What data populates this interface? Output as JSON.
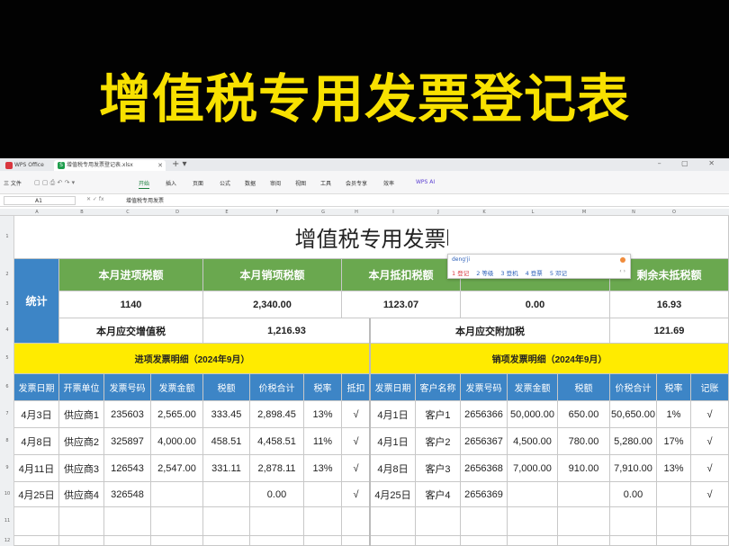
{
  "banner": {
    "title": "增值税专用发票登记表"
  },
  "tabs": [
    {
      "label": "WPS Office"
    },
    {
      "label": "增值税专用发票登记表.xlsx"
    }
  ],
  "ribbon": {
    "file": "三 文件",
    "items": [
      "开始",
      "插入",
      "页面",
      "公式",
      "数据",
      "审阅",
      "视图",
      "工具",
      "会员专享",
      "效率"
    ],
    "ai": "WPS AI",
    "active": "开始"
  },
  "formula_bar": {
    "cell_ref": "A1",
    "fx": "✕ ✓ fx",
    "value": "增值税专用发票"
  },
  "col_letters": [
    "A",
    "B",
    "C",
    "D",
    "E",
    "F",
    "G",
    "H",
    "I",
    "J",
    "K",
    "L",
    "M",
    "N",
    "O"
  ],
  "row_numbers": [
    "1",
    "2",
    "3",
    "4",
    "5",
    "6",
    "7",
    "8",
    "9",
    "10",
    "11",
    "12"
  ],
  "sheet": {
    "title": "增值税专用发票",
    "stat_label": "统计",
    "summary_headers": [
      "本月进项税额",
      "本月销项税额",
      "本月抵扣税额",
      "",
      "剩余未抵税额"
    ],
    "summary_values": [
      "1140",
      "2,340.00",
      "1123.07",
      "0.00",
      "16.93"
    ],
    "vat_due_label": "本月应交增值税",
    "vat_due_value": "1,216.93",
    "surcharge_label": "本月应交附加税",
    "surcharge_value": "121.69",
    "input_section": "进项发票明细（2024年9月）",
    "output_section": "销项发票明细（2024年9月）",
    "input_headers": [
      "发票日期",
      "开票单位",
      "发票号码",
      "发票金额",
      "税额",
      "价税合计",
      "税率",
      "抵扣"
    ],
    "output_headers": [
      "发票日期",
      "客户名称",
      "发票号码",
      "发票金额",
      "税额",
      "价税合计",
      "税率",
      "记账"
    ],
    "input_rows": [
      [
        "4月3日",
        "供应商1",
        "235603",
        "2,565.00",
        "333.45",
        "2,898.45",
        "13%",
        "√"
      ],
      [
        "4月8日",
        "供应商2",
        "325897",
        "4,000.00",
        "458.51",
        "4,458.51",
        "11%",
        "√"
      ],
      [
        "4月11日",
        "供应商3",
        "126543",
        "2,547.00",
        "331.11",
        "2,878.11",
        "13%",
        "√"
      ],
      [
        "4月25日",
        "供应商4",
        "326548",
        "",
        "",
        "0.00",
        "",
        "√"
      ]
    ],
    "output_rows": [
      [
        "4月1日",
        "客户1",
        "2656366",
        "50,000.00",
        "650.00",
        "50,650.00",
        "1%",
        "√"
      ],
      [
        "4月1日",
        "客户2",
        "2656367",
        "4,500.00",
        "780.00",
        "5,280.00",
        "17%",
        "√"
      ],
      [
        "4月8日",
        "客户3",
        "2656368",
        "7,000.00",
        "910.00",
        "7,910.00",
        "13%",
        "√"
      ],
      [
        "4月25日",
        "客户4",
        "2656369",
        "",
        "",
        "0.00",
        "",
        "√"
      ]
    ]
  },
  "ime": {
    "pinyin": "deng'ji",
    "candidates": [
      "1 登记",
      "2 等级",
      "3 登机",
      "4 登票",
      "5 邓记"
    ],
    "nav": "‹ ›"
  },
  "colors": {
    "green": "#6aa84f",
    "blue": "#3d85c6",
    "yellow": "#ffeb00",
    "banner_text": "#f8e100"
  }
}
